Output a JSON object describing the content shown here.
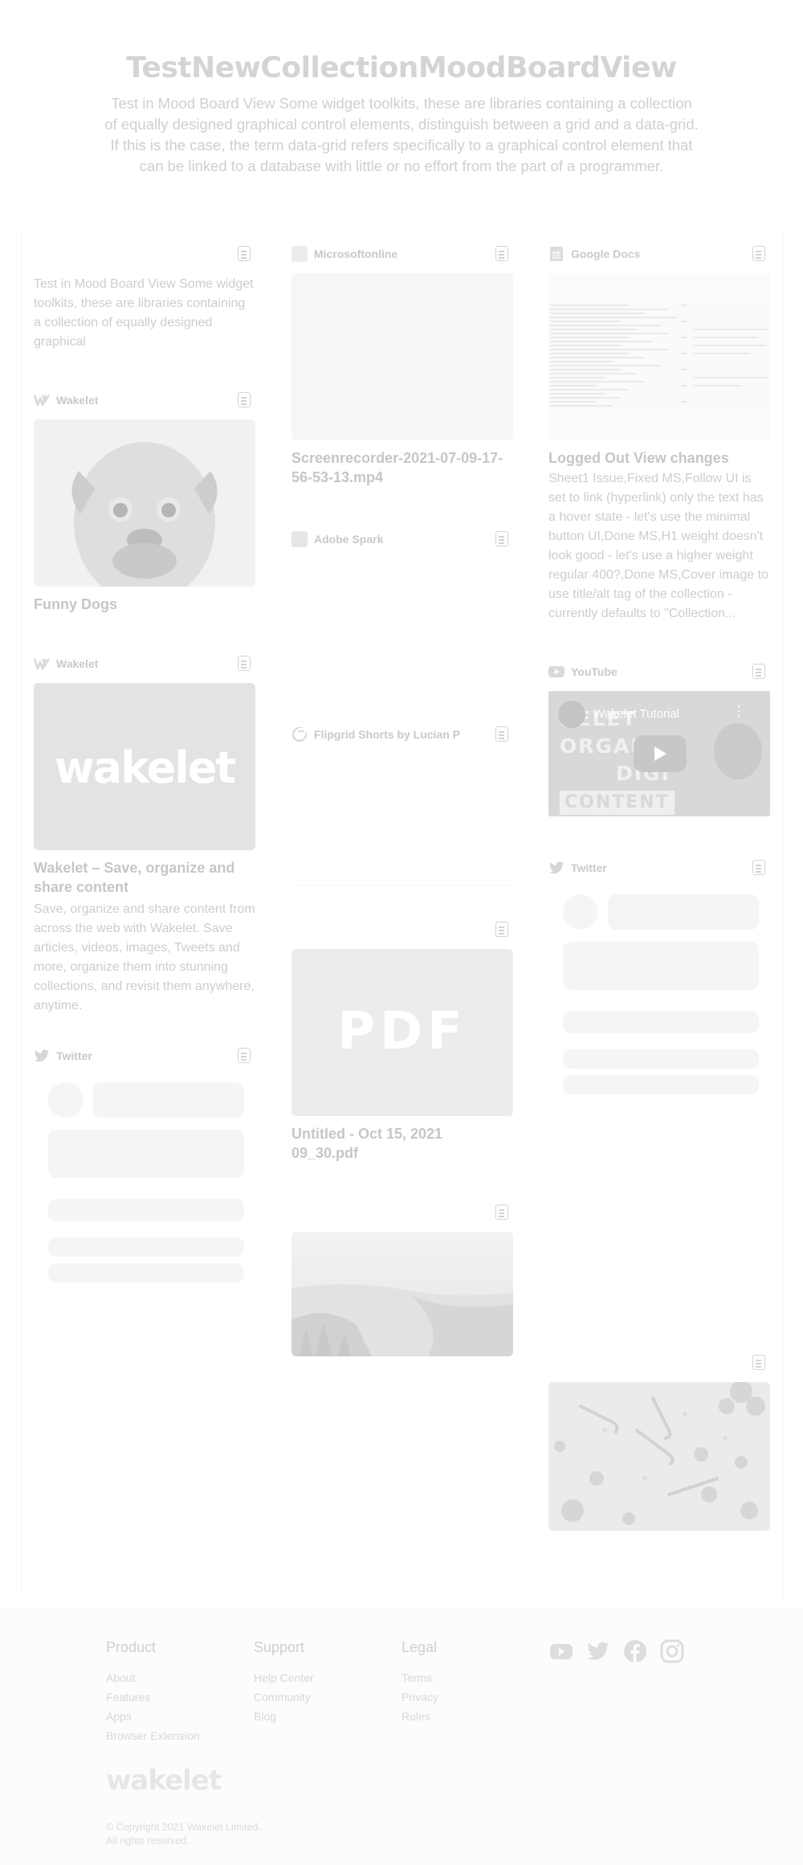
{
  "header": {
    "title": "TestNewCollectionMoodBoardView",
    "description": "Test in Mood Board View Some widget toolkits, these are libraries containing a collection of equally designed graphical control elements, distinguish between a grid and a data-grid. If this is the case, the term data-grid refers specifically to a graphical control element that can be linked to a database with little or no effort from the part of a programmer."
  },
  "cards": {
    "text_note": {
      "text": "Test in Mood Board View  Some widget toolkits, these are libraries containing a collection of equally designed graphical"
    },
    "funny_dogs": {
      "source": "Wakelet",
      "title": "Funny Dogs"
    },
    "wakelet_site": {
      "source": "Wakelet",
      "logo_text": "wakelet",
      "title": "Wakelet – Save, organize and share content",
      "text": "Save, organize and share content from across the web with Wakelet. Save articles, videos, images, Tweets and more, organize them into stunning collections, and revisit them anywhere, anytime."
    },
    "twitter_left": {
      "source": "Twitter"
    },
    "screenrecorder": {
      "source": "Microsoftonline",
      "title": "Screenrecorder-2021-07-09-17-56-53-13.mp4"
    },
    "adobe_spark": {
      "source": "Adobe Spark"
    },
    "flipgrid": {
      "source": "Flipgrid Shorts by Lucian P"
    },
    "pdf_file": {
      "thumb_text": "PDF",
      "title": "Untitled - Oct 15, 2021 09_30.pdf"
    },
    "coast_photo": {},
    "google_docs": {
      "source": "Google Docs",
      "title": "Logged Out View changes",
      "text": "Sheet1 Issue,Fixed MS,Follow UI is set to link (hyperlink) only the text has a hover state - let's use the minimal button UI,Done MS,H1 weight doesn't look good - let's use a higher weight regular 400?,Done MS,Cover image to use title/alt tag of the collection - currently defaults to \"Collection..."
    },
    "youtube": {
      "source": "YouTube",
      "video_title": "Wakelet Tutorial",
      "overlay_lines": [
        "KELET",
        "ORGAN",
        "DIGI",
        "CONTENT"
      ]
    },
    "twitter_right": {
      "source": "Twitter"
    },
    "holiday_photo": {}
  },
  "footer": {
    "product": {
      "heading": "Product",
      "links": [
        "About",
        "Features",
        "Apps",
        "Browser Extension"
      ]
    },
    "support": {
      "heading": "Support",
      "links": [
        "Help Center",
        "Community",
        "Blog"
      ]
    },
    "legal": {
      "heading": "Legal",
      "links": [
        "Terms",
        "Privacy",
        "Rules"
      ]
    },
    "social_icons": [
      "youtube-icon",
      "twitter-icon",
      "facebook-icon",
      "instagram-icon"
    ],
    "logo_text": "wakelet",
    "copyright_line1": "© Copyright 2021 Wakelet Limited.",
    "copyright_line2": "All rights reserved."
  }
}
